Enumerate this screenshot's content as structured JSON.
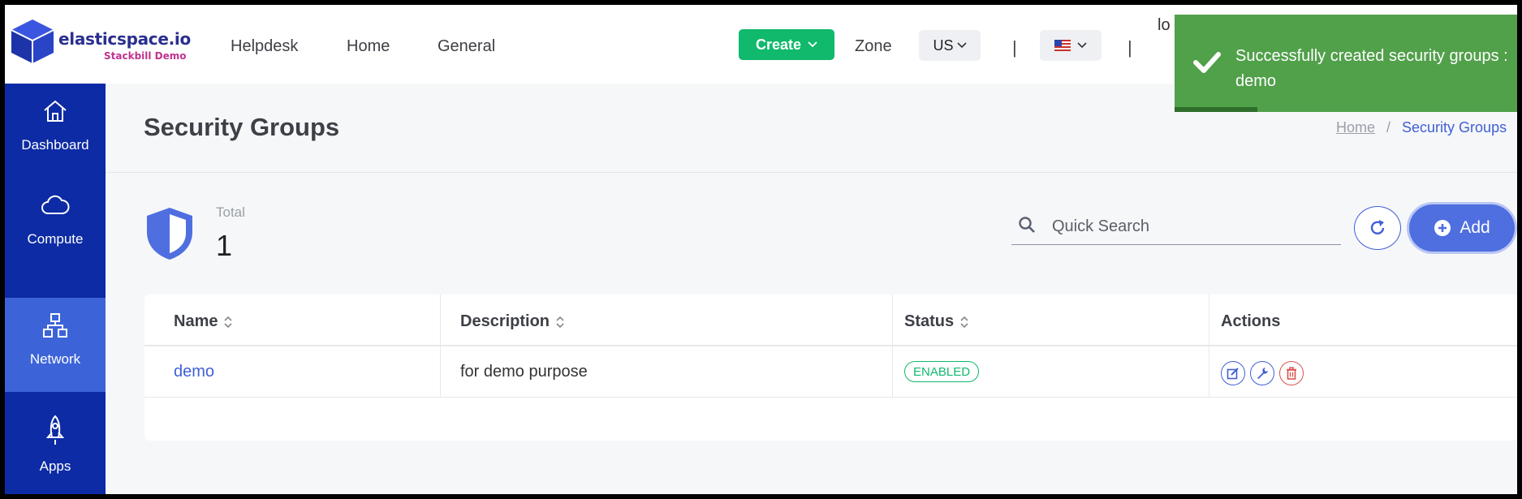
{
  "header": {
    "logo_name": "elasticspace.io",
    "logo_sub": "Stackbill Demo",
    "nav": [
      "Helpdesk",
      "Home",
      "General"
    ],
    "create_label": "Create",
    "zone_label": "Zone",
    "zone_value": "US",
    "separator": "|",
    "user_text": "lo"
  },
  "sidebar": {
    "items": [
      {
        "label": "Dashboard",
        "icon": "home-icon"
      },
      {
        "label": "Compute",
        "icon": "cloud-icon"
      },
      {
        "label": "Network",
        "icon": "network-icon"
      },
      {
        "label": "Apps",
        "icon": "rocket-icon"
      }
    ],
    "active": "Network"
  },
  "page": {
    "title": "Security Groups",
    "breadcrumb": {
      "home": "Home",
      "sep": "/",
      "current": "Security Groups"
    }
  },
  "summary": {
    "total_label": "Total",
    "total_value": "1"
  },
  "toolbar": {
    "search_placeholder": "Quick Search",
    "add_label": "Add"
  },
  "table": {
    "headers": [
      "Name",
      "Description",
      "Status",
      "Actions"
    ],
    "rows": [
      {
        "name": "demo",
        "description": "for demo purpose",
        "status": "ENABLED"
      }
    ]
  },
  "toast": {
    "message": "Successfully created security groups : demo"
  },
  "colors": {
    "accent": "#3f5fd6",
    "sidebar": "#0d2ba4",
    "success": "#10b96c",
    "toast": "#51a04a",
    "danger": "#d9534f"
  }
}
